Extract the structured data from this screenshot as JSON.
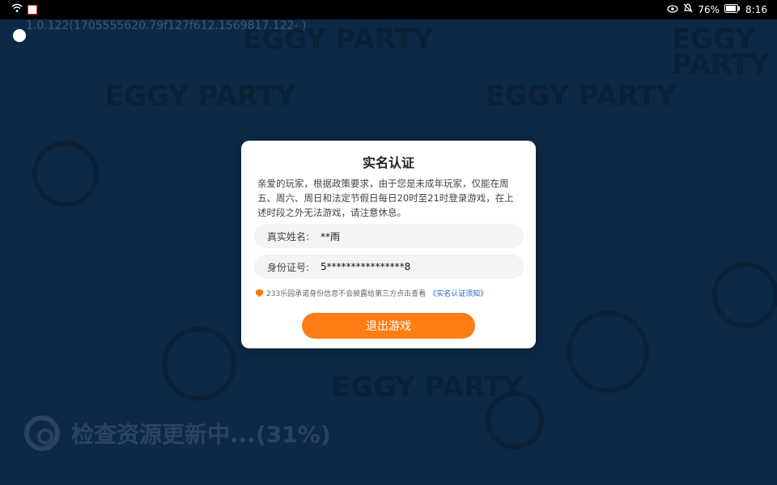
{
  "status_bar": {
    "battery": "76%",
    "time": "8:16"
  },
  "app": {
    "version": "1.0.122(1705555620.79f127f612.1569817.122- )",
    "loading_text": "检查资源更新中...(31%)",
    "background_logo": "EGGY PARTY"
  },
  "dialog": {
    "title": "实名认证",
    "message": "亲爱的玩家，根据政策要求，由于您是未成年玩家，仅能在周五、周六、周日和法定节假日每日20时至21时登录游戏，在上述时段之外无法游戏，请注意休息。",
    "fields": [
      {
        "label": "真实姓名:",
        "value": "**雨"
      },
      {
        "label": "身份证号:",
        "value": "5****************8"
      }
    ],
    "notice_text": "233乐园承诺身份信息不会披露给第三方点击查看",
    "notice_link": "《实名认证须知》",
    "exit_button": "退出游戏"
  },
  "colors": {
    "accent": "#ff7d14",
    "link": "#2066c5",
    "background": "#0c2a45"
  }
}
